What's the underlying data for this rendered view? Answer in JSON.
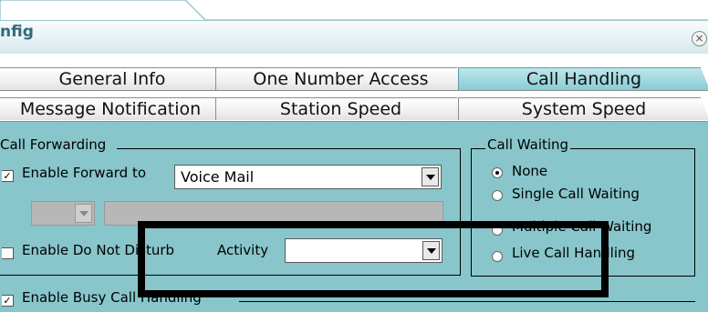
{
  "window": {
    "title": "nfig",
    "close_icon": "close-icon"
  },
  "tabs": {
    "row1": [
      {
        "label": "General Info",
        "active": false
      },
      {
        "label": "One Number Access",
        "active": false
      },
      {
        "label": "Call Handling",
        "active": true
      }
    ],
    "row2": [
      {
        "label": "Message Notification",
        "active": false
      },
      {
        "label": "Station Speed",
        "active": false
      },
      {
        "label": "System Speed",
        "active": false
      }
    ]
  },
  "call_forwarding": {
    "group_label": "Call Forwarding",
    "enable_forward": {
      "label": "Enable Forward to",
      "checked": true,
      "checkmark": "✓"
    },
    "forward_to": {
      "value": "Voice Mail"
    },
    "enable_dnd": {
      "label": "Enable Do Not Disturb",
      "checked": false
    },
    "activity": {
      "label": "Activity",
      "value": ""
    },
    "enable_busy": {
      "label": "Enable Busy Call Handling",
      "checked": true,
      "checkmark": "✓"
    }
  },
  "call_waiting": {
    "group_label": "Call Waiting",
    "options": [
      {
        "label": "None",
        "selected": true
      },
      {
        "label": "Single Call Waiting",
        "selected": false
      },
      {
        "label": "Multiple Call Waiting",
        "selected": false
      },
      {
        "label": "Live Call Handling",
        "selected": false
      }
    ]
  },
  "colors": {
    "panel": "#88c6cb",
    "active_tab": "#86cdd4",
    "title": "#2f6b7d"
  }
}
